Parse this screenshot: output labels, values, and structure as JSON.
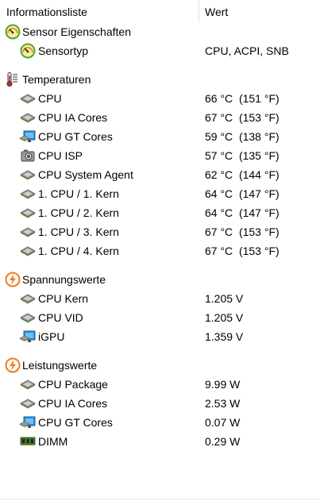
{
  "header": {
    "col1": "Informationsliste",
    "col2": "Wert"
  },
  "sensor": {
    "category": "Sensor Eigenschaften",
    "label": "Sensortyp",
    "value": "CPU, ACPI, SNB"
  },
  "temperatures": {
    "category": "Temperaturen",
    "items": [
      {
        "label": "CPU",
        "value": "66 °C  (151 °F)",
        "icon": "chip-icon"
      },
      {
        "label": "CPU IA Cores",
        "value": "67 °C  (153 °F)",
        "icon": "chip-icon"
      },
      {
        "label": "CPU GT Cores",
        "value": "59 °C  (138 °F)",
        "icon": "gpu-monitor-icon"
      },
      {
        "label": "CPU ISP",
        "value": "57 °C  (135 °F)",
        "icon": "camera-icon"
      },
      {
        "label": "CPU System Agent",
        "value": "62 °C  (144 °F)",
        "icon": "chip-icon"
      },
      {
        "label": "1. CPU / 1. Kern",
        "value": "64 °C  (147 °F)",
        "icon": "chip-icon"
      },
      {
        "label": "1. CPU / 2. Kern",
        "value": "64 °C  (147 °F)",
        "icon": "chip-icon"
      },
      {
        "label": "1. CPU / 3. Kern",
        "value": "67 °C  (153 °F)",
        "icon": "chip-icon"
      },
      {
        "label": "1. CPU / 4. Kern",
        "value": "67 °C  (153 °F)",
        "icon": "chip-icon"
      }
    ]
  },
  "voltages": {
    "category": "Spannungswerte",
    "items": [
      {
        "label": "CPU Kern",
        "value": "1.205 V",
        "icon": "chip-icon"
      },
      {
        "label": "CPU VID",
        "value": "1.205 V",
        "icon": "chip-icon"
      },
      {
        "label": "iGPU",
        "value": "1.359 V",
        "icon": "gpu-monitor-icon"
      }
    ]
  },
  "power": {
    "category": "Leistungswerte",
    "items": [
      {
        "label": "CPU Package",
        "value": "9.99 W",
        "icon": "chip-icon"
      },
      {
        "label": "CPU IA Cores",
        "value": "2.53 W",
        "icon": "chip-icon"
      },
      {
        "label": "CPU GT Cores",
        "value": "0.07 W",
        "icon": "gpu-monitor-icon"
      },
      {
        "label": "DIMM",
        "value": "0.29 W",
        "icon": "memory-module-icon"
      }
    ]
  },
  "colors": {
    "chip": "#8a8a8a",
    "chip_pins": "#5a8a3c",
    "monitor": "#2d8fd6",
    "lightning_orange": "#f07c1a",
    "thermometer_red": "#d32020",
    "gauge_green": "#4caa35"
  }
}
